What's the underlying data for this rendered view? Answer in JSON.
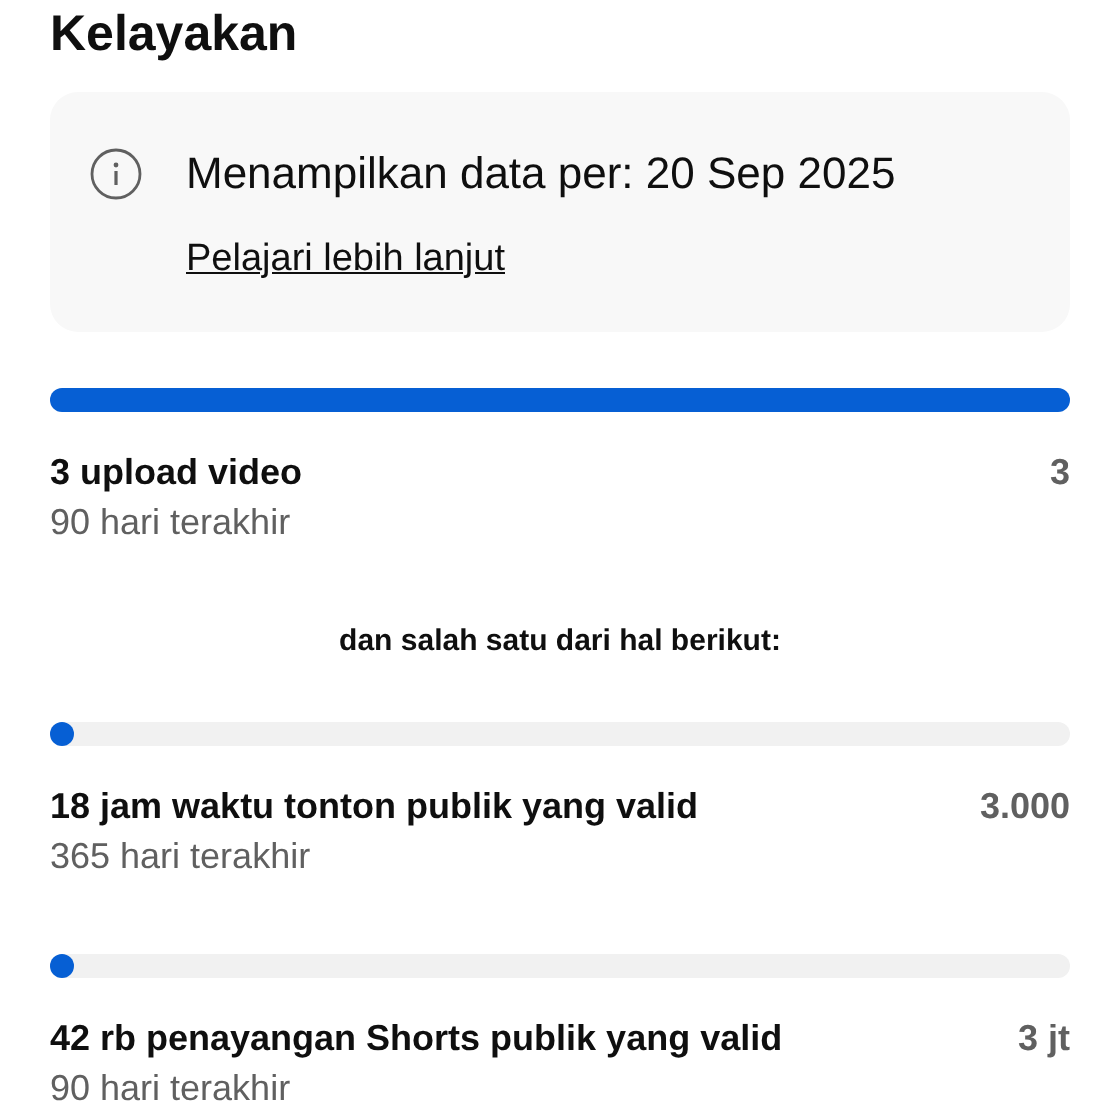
{
  "title": "Kelayakan",
  "notice": {
    "text": "Menampilkan data per: 20 Sep 2025",
    "link": "Pelajari lebih lanjut"
  },
  "requirements": [
    {
      "label": "3 upload video",
      "value": "3",
      "period": "90 hari terakhir",
      "level": 1
    }
  ],
  "separator": "dan salah satu dari hal berikut:",
  "alternatives": [
    {
      "label": "18 jam waktu tonton publik yang valid",
      "value": "3.000",
      "period": "365 hari terakhir",
      "level": 0
    },
    {
      "label": "42 rb penayangan Shorts publik yang valid",
      "value": "3 jt",
      "period": "90 hari terakhir",
      "level": 0
    }
  ]
}
